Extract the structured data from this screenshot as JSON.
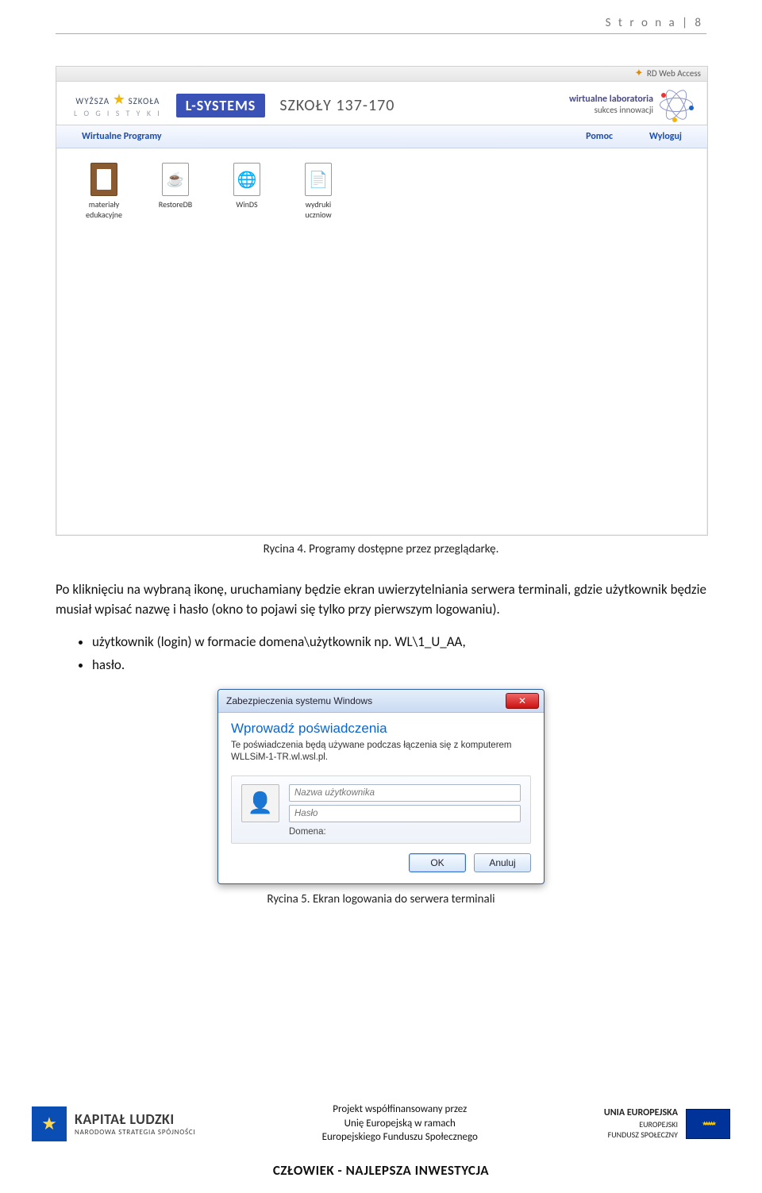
{
  "page_header": "S t r o n a  | 8",
  "rd": {
    "top_link": "RD Web Access",
    "logo_top": "WYŻSZA ★ SZKOŁA",
    "logo_bottom": "L O G I S T Y K I",
    "lsystems": "L-SYSTEMS",
    "szkoly": "SZKOŁY 137-170",
    "wlab1": "wirtualne laboratoria",
    "wlab2": "sukces innowacji",
    "nav_tab": "Wirtualne Programy",
    "nav_help": "Pomoc",
    "nav_logout": "Wyloguj",
    "apps": [
      {
        "name": "materiały edukacyjne",
        "icon": "clipboard"
      },
      {
        "name": "RestoreDB",
        "icon": "java"
      },
      {
        "name": "WinDS",
        "icon": "globe"
      },
      {
        "name": "wydruki uczniow",
        "icon": "doc"
      }
    ]
  },
  "caption1": "Rycina 4. Programy dostępne przez przeglądarkę.",
  "paragraph": "Po kliknięciu na wybraną ikonę, uruchamiany będzie ekran uwierzytelniania serwera terminali, gdzie użytkownik będzie musiał wpisać nazwę i hasło (okno to pojawi się tylko przy pierwszym logowaniu).",
  "bullet1": "użytkownik (login) w formacie domena\\użytkownik np. WL\\1_U_AA,",
  "bullet2": "hasło.",
  "dlg": {
    "title": "Zabezpieczenia systemu Windows",
    "heading": "Wprowadź poświadczenia",
    "subtext": "Te poświadczenia będą używane podczas łączenia się z komputerem WLLSiM-1-TR.wl.wsl.pl.",
    "ph_user": "Nazwa użytkownika",
    "ph_pass": "Hasło",
    "domain_label": "Domena:",
    "btn_ok": "OK",
    "btn_cancel": "Anuluj"
  },
  "caption2": "Rycina 5. Ekran logowania do serwera terminali",
  "footer": {
    "kl_big": "KAPITAŁ LUDZKI",
    "kl_small": "NARODOWA STRATEGIA SPÓJNOŚCI",
    "center_l1": "Projekt współfinansowany przez",
    "center_l2": "Unię Europejską w ramach",
    "center_l3": "Europejskiego Funduszu Społecznego",
    "ue_big": "UNIA EUROPEJSKA",
    "ue_l2": "EUROPEJSKI",
    "ue_l3": "FUNDUSZ SPOŁECZNY",
    "slogan": "CZŁOWIEK - NAJLEPSZA INWESTYCJA"
  }
}
